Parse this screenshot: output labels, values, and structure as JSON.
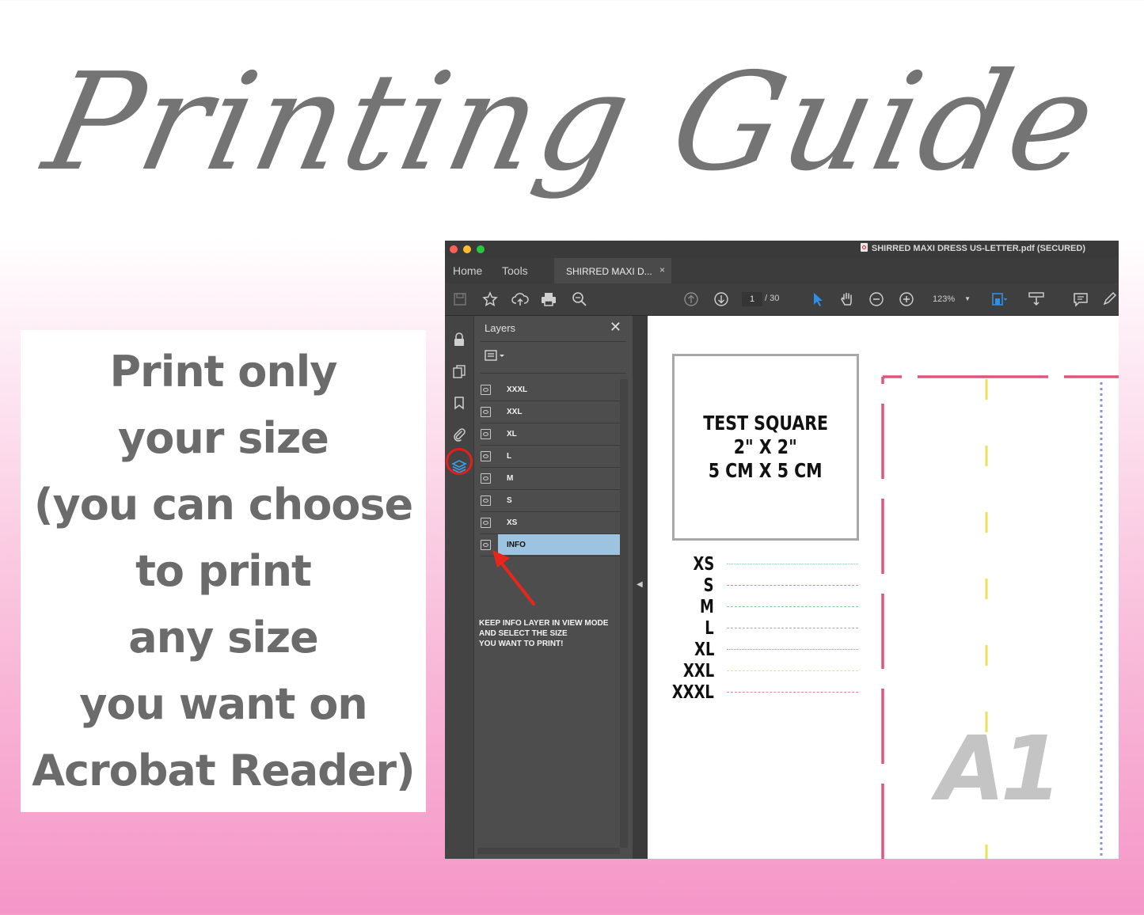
{
  "title": "Printing Guide",
  "instructions": {
    "lines": [
      "Print only",
      "your size",
      "(you can choose",
      "to print",
      "any size",
      "you want on",
      "Acrobat Reader)"
    ]
  },
  "window": {
    "title": "SHIRRED MAXI DRESS US-LETTER.pdf (SECURED)",
    "tabs": {
      "home": "Home",
      "tools": "Tools",
      "document": "SHIRRED MAXI D...",
      "close": "×"
    },
    "toolbar": {
      "page_current": "1",
      "page_total": "/ 30",
      "zoom": "123%"
    },
    "layers_panel": {
      "title": "Layers",
      "close": "✕",
      "layers": [
        "XXXL",
        "XXL",
        "XL",
        "L",
        "M",
        "S",
        "XS",
        "INFO"
      ],
      "selected": "INFO",
      "note_lines": [
        "KEEP INFO LAYER IN VIEW MODE",
        "AND SELECT THE SIZE",
        "YOU WANT TO PRINT!"
      ]
    },
    "document": {
      "test_square": [
        "TEST SQUARE",
        "2\" X 2\"",
        "5 CM X 5 CM"
      ],
      "size_legend": [
        {
          "label": "XS",
          "color": "#79c9d6",
          "style": "dotted"
        },
        {
          "label": "S",
          "color": "#e48a6a",
          "style": "dashdot"
        },
        {
          "label": "M",
          "color": "#7dcf8a",
          "style": "dashed"
        },
        {
          "label": "L",
          "color": "#a9a9a9",
          "style": "longdash"
        },
        {
          "label": "XL",
          "color": "#8c8fd1",
          "style": "dotted"
        },
        {
          "label": "XXL",
          "color": "#e8e27a",
          "style": "dashed"
        },
        {
          "label": "XXXL",
          "color": "#d98aa0",
          "style": "longdash"
        }
      ],
      "piece_label": "A1"
    }
  },
  "colors": {
    "accent_red": "#e31e1e",
    "layer_highlight": "#9cc3df",
    "toolbar_blue": "#2f8fe8",
    "pattern_pink": "#e0557e",
    "pattern_yellow": "#e8e15a",
    "pattern_purple": "#8f93d6"
  }
}
